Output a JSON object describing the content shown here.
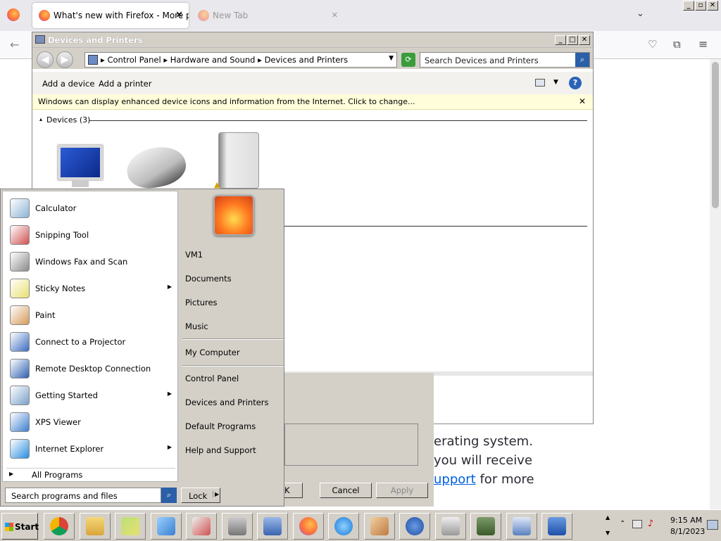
{
  "browser": {
    "tabs": [
      {
        "title": "What's new with Firefox - More pr"
      },
      {
        "title": "New Tab"
      }
    ],
    "page_text": {
      "line1": "erating system.",
      "line2": "you will receive",
      "line3_link": "upport",
      "line3_rest": "for more"
    }
  },
  "window": {
    "title": "Devices and Printers",
    "min": "_",
    "max": "□",
    "close": "✕",
    "breadcrumb": [
      "Control Panel",
      "Hardware and Sound",
      "Devices and Printers"
    ],
    "search_placeholder": "Search Devices and Printers",
    "commands": {
      "add_device": "Add a device",
      "add_printer": "Add a printer"
    },
    "info_bar": "Windows can display enhanced device icons and information from the Internet. Click to change...",
    "group_label": "Devices (3)"
  },
  "dialog": {
    "ok": "OK",
    "cancel": "Cancel",
    "apply": "Apply"
  },
  "start_menu": {
    "programs": [
      {
        "label": "Calculator",
        "icon": "calculator-icon",
        "arrow": false
      },
      {
        "label": "Snipping Tool",
        "icon": "scissors-icon",
        "arrow": false
      },
      {
        "label": "Windows Fax and Scan",
        "icon": "fax-icon",
        "arrow": false
      },
      {
        "label": "Sticky Notes",
        "icon": "sticky-notes-icon",
        "arrow": true
      },
      {
        "label": "Paint",
        "icon": "paint-icon",
        "arrow": false
      },
      {
        "label": "Connect to a Projector",
        "icon": "projector-icon",
        "arrow": false
      },
      {
        "label": "Remote Desktop Connection",
        "icon": "remote-desktop-icon",
        "arrow": false
      },
      {
        "label": "Getting Started",
        "icon": "getting-started-icon",
        "arrow": true
      },
      {
        "label": "XPS Viewer",
        "icon": "xps-icon",
        "arrow": false
      },
      {
        "label": "Internet Explorer",
        "icon": "ie-icon",
        "arrow": true
      }
    ],
    "all_programs": "All Programs",
    "search_placeholder": "Search programs and files",
    "right_items": [
      "VM1",
      "Documents",
      "Pictures",
      "Music",
      "My Computer",
      "Control Panel",
      "Devices and Printers",
      "Default Programs",
      "Help and Support"
    ],
    "lock": "Lock"
  },
  "taskbar": {
    "start": "Start",
    "apps": [
      "chrome-icon",
      "explorer-icon",
      "sticky-notes-icon",
      "xps-icon",
      "scissors-icon",
      "fax-icon",
      "control-panel-icon",
      "firefox-icon",
      "ie-icon",
      "paint-icon",
      "help-icon",
      "backup-icon",
      "network-icon",
      "documents-icon",
      "remote-desktop-icon"
    ],
    "time": "9:15 AM",
    "date": "8/1/2023"
  }
}
